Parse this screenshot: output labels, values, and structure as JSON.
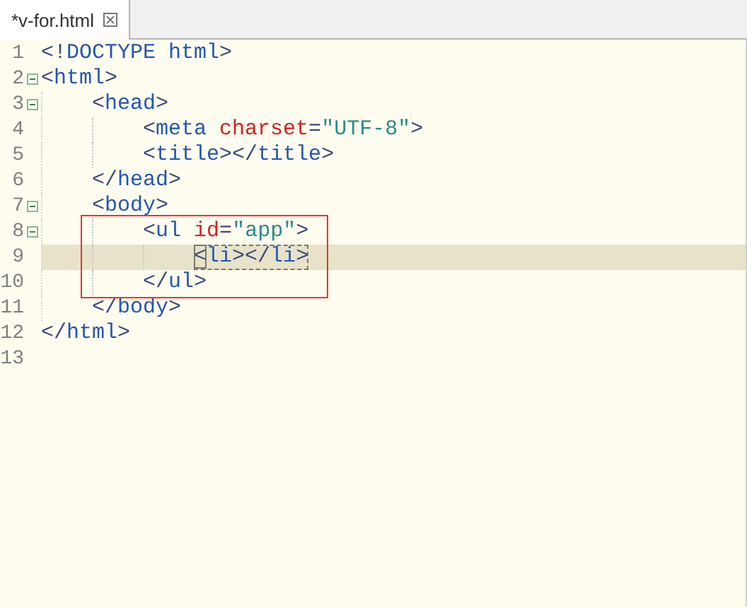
{
  "tab": {
    "title": "*v-for.html",
    "selected": true
  },
  "lines": [
    {
      "number": "1",
      "fold": false,
      "current": false,
      "match": false,
      "tokens": [
        {
          "kind": "punct",
          "text": "<!"
        },
        {
          "kind": "tag",
          "text": "DOCTYPE html"
        },
        {
          "kind": "punct",
          "text": ">"
        }
      ]
    },
    {
      "number": "2",
      "fold": true,
      "current": false,
      "match": false,
      "tokens": [
        {
          "kind": "punct",
          "text": "<"
        },
        {
          "kind": "tag",
          "text": "html"
        },
        {
          "kind": "punct",
          "text": ">"
        }
      ],
      "children": [
        {
          "number": "3",
          "fold": true,
          "current": false,
          "match": false,
          "tokens": [
            {
              "kind": "punct",
              "text": "<"
            },
            {
              "kind": "tag",
              "text": "head"
            },
            {
              "kind": "punct",
              "text": ">"
            }
          ],
          "children": [
            {
              "number": "4",
              "fold": false,
              "current": false,
              "match": false,
              "tokens": [
                {
                  "kind": "punct",
                  "text": "<"
                },
                {
                  "kind": "tag",
                  "text": "meta "
                },
                {
                  "kind": "attr",
                  "text": "charset"
                },
                {
                  "kind": "punct",
                  "text": "="
                },
                {
                  "kind": "value",
                  "text": "\"UTF-8\""
                },
                {
                  "kind": "punct",
                  "text": ">"
                }
              ]
            },
            {
              "number": "5",
              "fold": false,
              "current": false,
              "match": false,
              "tokens": [
                {
                  "kind": "punct",
                  "text": "<"
                },
                {
                  "kind": "tag",
                  "text": "title"
                },
                {
                  "kind": "punct",
                  "text": "></"
                },
                {
                  "kind": "tag",
                  "text": "title"
                },
                {
                  "kind": "punct",
                  "text": ">"
                }
              ]
            }
          ]
        },
        {
          "number": "6",
          "fold": false,
          "current": false,
          "match": false,
          "tokens": [
            {
              "kind": "punct",
              "text": "</"
            },
            {
              "kind": "tag",
              "text": "head"
            },
            {
              "kind": "punct",
              "text": ">"
            }
          ]
        },
        {
          "number": "7",
          "fold": true,
          "current": false,
          "match": false,
          "tokens": [
            {
              "kind": "punct",
              "text": "<"
            },
            {
              "kind": "tag",
              "text": "body"
            },
            {
              "kind": "punct",
              "text": ">"
            }
          ],
          "children": [
            {
              "number": "8",
              "fold": true,
              "current": false,
              "match": false,
              "tokens": [
                {
                  "kind": "punct",
                  "text": "<"
                },
                {
                  "kind": "tag",
                  "text": "ul "
                },
                {
                  "kind": "attr",
                  "text": "id"
                },
                {
                  "kind": "punct",
                  "text": "="
                },
                {
                  "kind": "value",
                  "text": "\"app\""
                },
                {
                  "kind": "punct",
                  "text": ">"
                }
              ],
              "children": [
                {
                  "number": "9",
                  "fold": false,
                  "current": true,
                  "match": true,
                  "tokens": [
                    {
                      "kind": "punct",
                      "text": "<"
                    },
                    {
                      "kind": "tag",
                      "text": "li"
                    },
                    {
                      "kind": "punct",
                      "text": "></"
                    },
                    {
                      "kind": "tag",
                      "text": "li"
                    },
                    {
                      "kind": "punct",
                      "text": ">"
                    }
                  ]
                }
              ]
            },
            {
              "number": "10",
              "fold": false,
              "current": false,
              "match": false,
              "tokens": [
                {
                  "kind": "punct",
                  "text": "</"
                },
                {
                  "kind": "tag",
                  "text": "ul"
                },
                {
                  "kind": "punct",
                  "text": ">"
                }
              ]
            }
          ]
        },
        {
          "number": "11",
          "fold": false,
          "current": false,
          "match": false,
          "tokens": [
            {
              "kind": "punct",
              "text": "</"
            },
            {
              "kind": "tag",
              "text": "body"
            },
            {
              "kind": "punct",
              "text": ">"
            }
          ]
        }
      ]
    },
    {
      "number": "12",
      "fold": false,
      "current": false,
      "match": false,
      "tokens": [
        {
          "kind": "punct",
          "text": "</"
        },
        {
          "kind": "tag",
          "text": "html"
        },
        {
          "kind": "punct",
          "text": ">"
        }
      ]
    },
    {
      "number": "13",
      "fold": false,
      "current": false,
      "match": false
    }
  ],
  "annotation": {
    "kind": "rectangle",
    "color": "#e8323c"
  }
}
